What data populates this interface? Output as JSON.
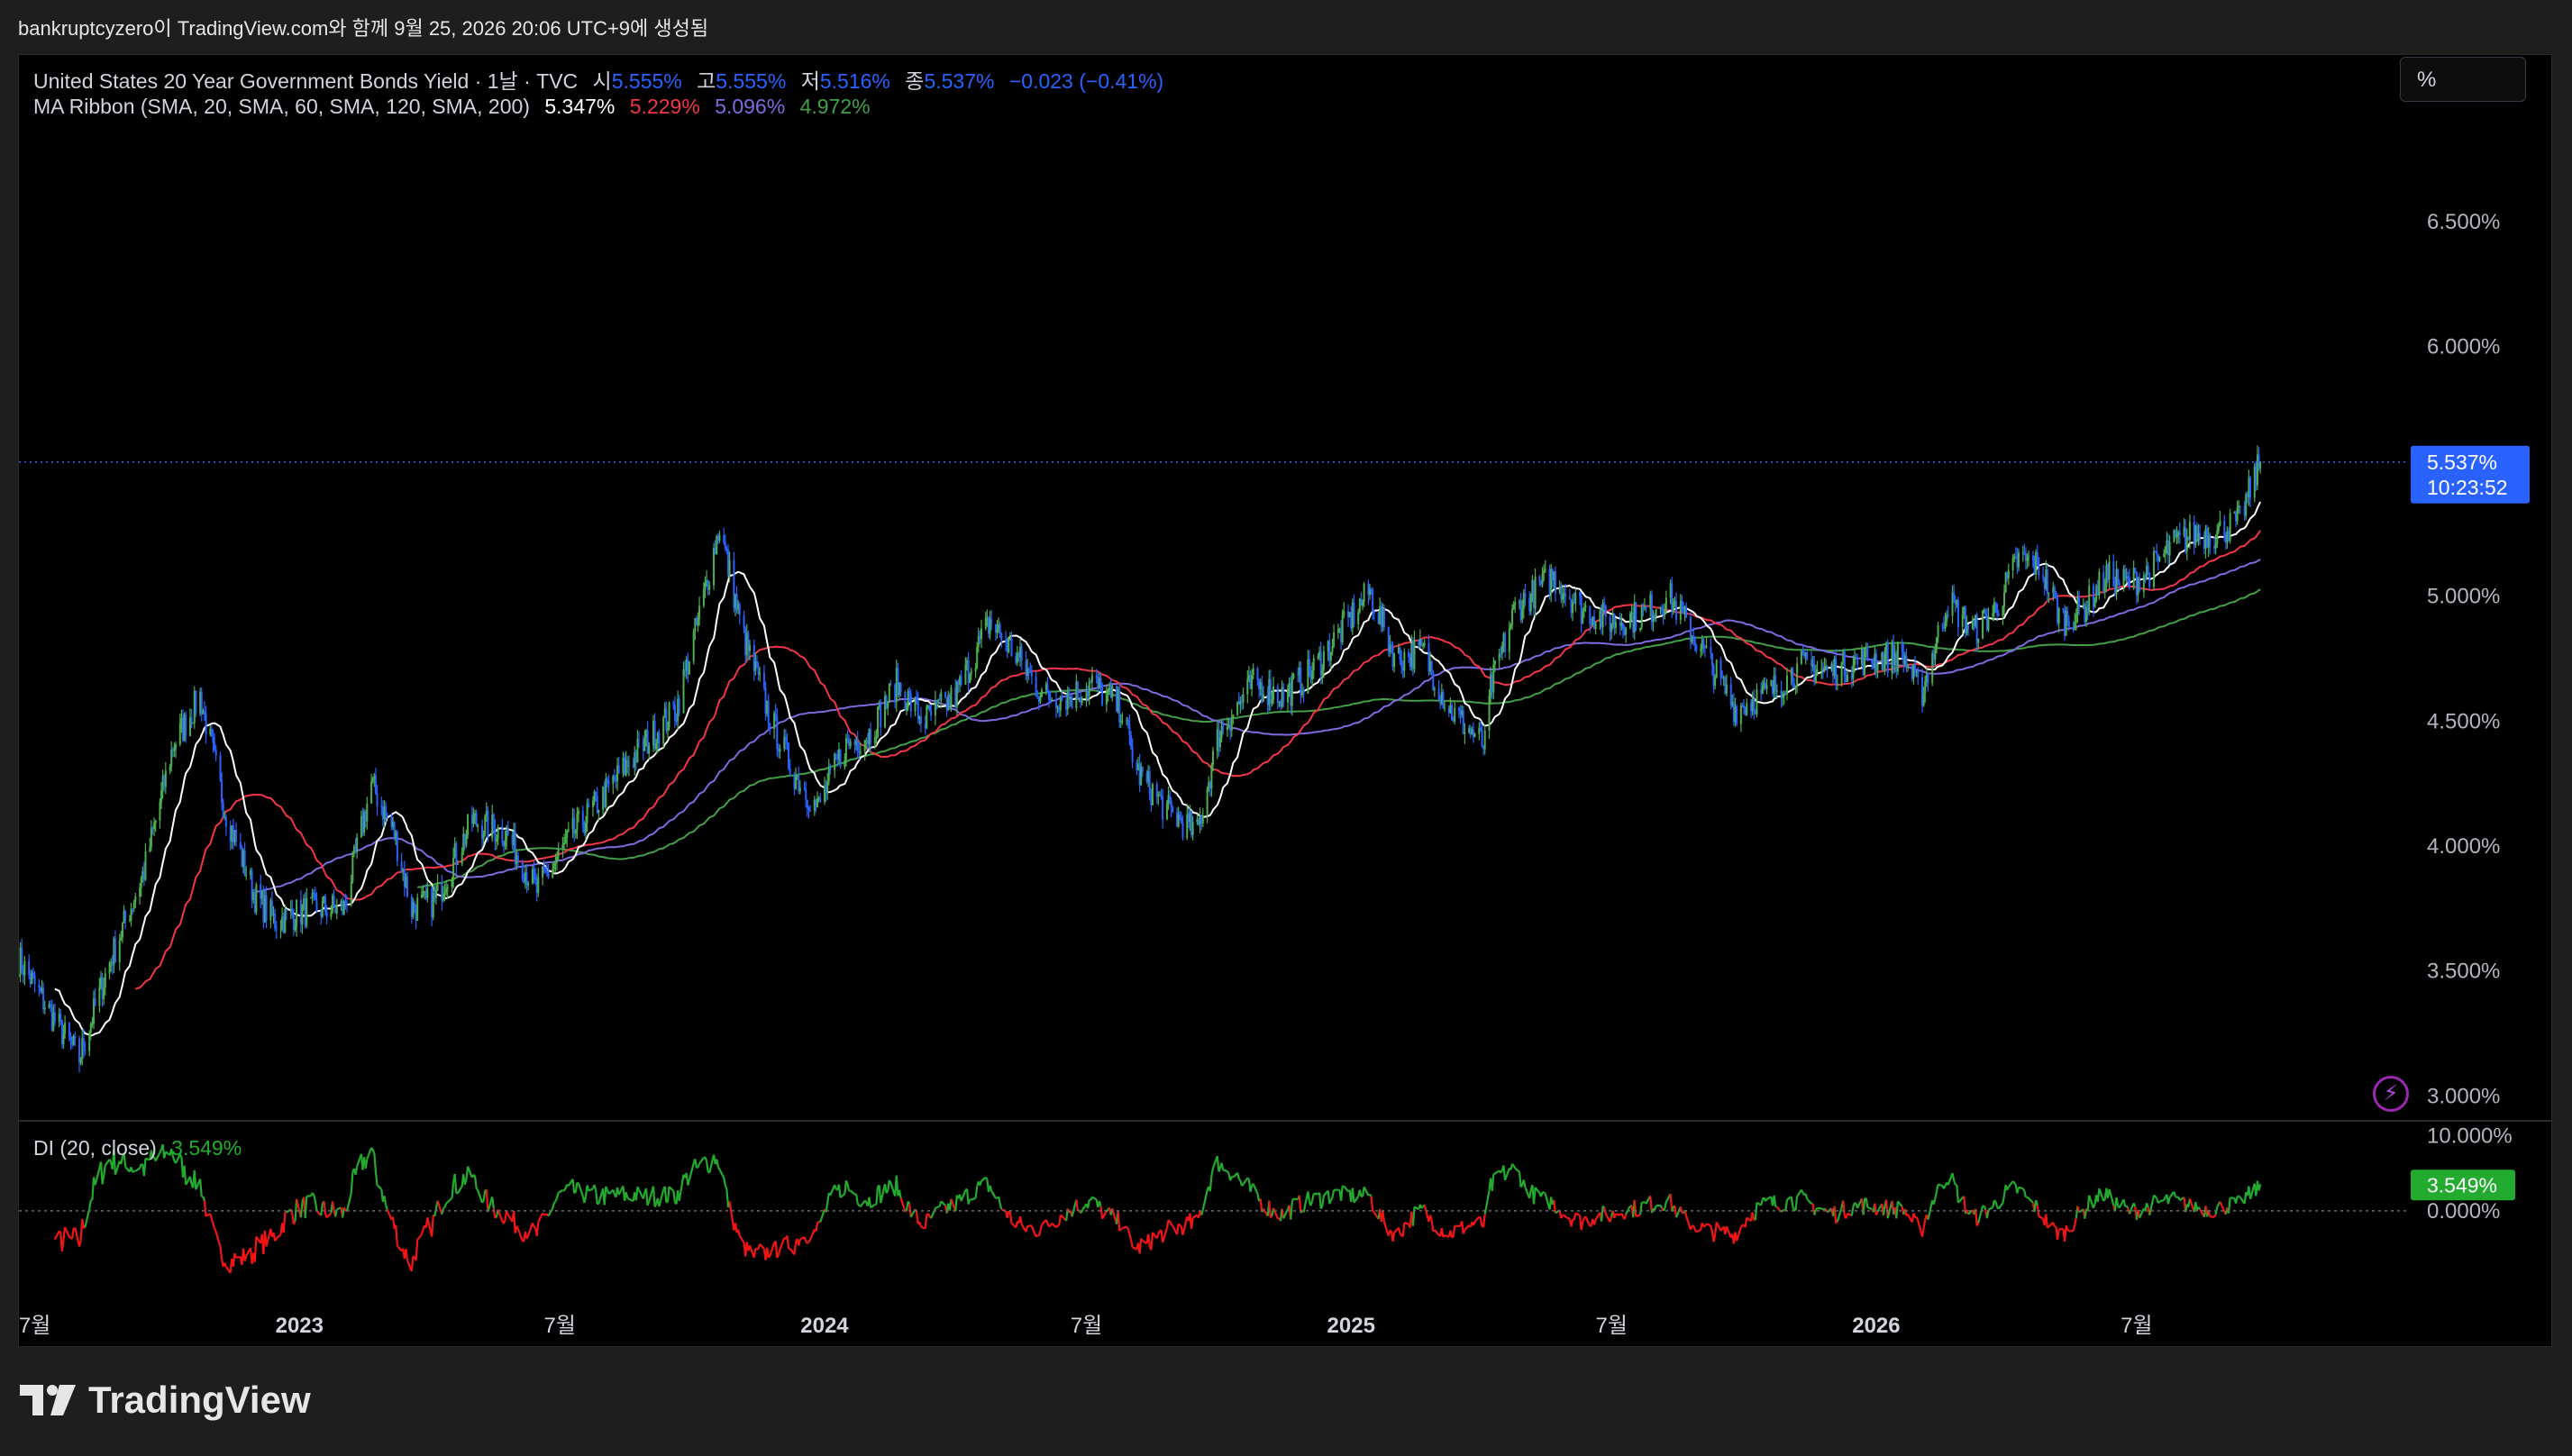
{
  "caption": "bankruptcyzero이 TradingView.com와 함께 9월 25, 2026 20:06 UTC+9에 생성됨",
  "legend": {
    "title": "United States 20 Year Government Bonds Yield · 1날 · TVC",
    "open_label": "시",
    "open": "5.555%",
    "high_label": "고",
    "high": "5.555%",
    "low_label": "저",
    "low": "5.516%",
    "close_label": "종",
    "close": "5.537%",
    "change": "−0.023 (−0.41%)",
    "ma_title": "MA Ribbon (SMA, 20, SMA, 60, SMA, 120, SMA, 200)",
    "ma20": "5.347%",
    "ma60": "5.229%",
    "ma120": "5.096%",
    "ma200": "4.972%"
  },
  "unit_button": "%",
  "price_badge": {
    "value": "5.537%",
    "countdown": "10:23:52"
  },
  "di_legend": {
    "label": "DI (20, close)",
    "value": "3.549%"
  },
  "di_badge": "3.549%",
  "brand": "TradingView",
  "colors": {
    "up": "#4caf50",
    "down": "#2962ff",
    "ma20": "#ffffff",
    "ma60": "#f23645",
    "ma120": "#7e6be0",
    "ma200": "#43a047",
    "di_up": "#22ab2e",
    "di_down": "#f21515",
    "badge_price": "#2962ff",
    "badge_di": "#22ab2e"
  },
  "chart_data": {
    "type": "line",
    "title": "United States 20 Year Government Bonds Yield",
    "y_ticks": [
      "6.500%",
      "6.000%",
      "5.000%",
      "4.500%",
      "4.000%",
      "3.500%",
      "3.000%"
    ],
    "y_tick_values": [
      6.5,
      6.0,
      5.0,
      4.5,
      4.0,
      3.5,
      3.0
    ],
    "ylim": [
      2.9,
      6.95
    ],
    "x_ticks": [
      {
        "label": "7월",
        "x": "2022-07-01"
      },
      {
        "label": "2023",
        "x": "2023-01-01"
      },
      {
        "label": "7월",
        "x": "2023-07-01"
      },
      {
        "label": "2024",
        "x": "2024-01-01"
      },
      {
        "label": "7월",
        "x": "2024-07-01"
      },
      {
        "label": "2025",
        "x": "2025-01-01"
      },
      {
        "label": "7월",
        "x": "2025-07-01"
      },
      {
        "label": "2026",
        "x": "2026-01-01"
      },
      {
        "label": "7월",
        "x": "2026-07-01"
      }
    ],
    "xlim": [
      "2022-06-20",
      "2027-01-05"
    ],
    "series": [
      {
        "name": "United States 20 Year Government Bonds Yield",
        "x": [
          "2022-06-20",
          "2022-07-15",
          "2022-08-01",
          "2022-08-20",
          "2022-09-15",
          "2022-10-05",
          "2022-10-24",
          "2022-11-10",
          "2022-12-01",
          "2022-12-15",
          "2023-01-10",
          "2023-02-01",
          "2023-02-20",
          "2023-03-08",
          "2023-03-20",
          "2023-04-05",
          "2023-05-01",
          "2023-05-25",
          "2023-06-15",
          "2023-07-10",
          "2023-07-31",
          "2023-08-20",
          "2023-09-20",
          "2023-10-05",
          "2023-10-20",
          "2023-11-05",
          "2023-11-25",
          "2023-12-10",
          "2023-12-27",
          "2024-01-15",
          "2024-02-01",
          "2024-02-20",
          "2024-03-10",
          "2024-04-01",
          "2024-04-25",
          "2024-05-15",
          "2024-06-01",
          "2024-06-20",
          "2024-07-05",
          "2024-07-25",
          "2024-08-05",
          "2024-08-25",
          "2024-09-16",
          "2024-10-01",
          "2024-10-25",
          "2024-11-15",
          "2024-12-05",
          "2025-01-14",
          "2025-02-01",
          "2025-02-20",
          "2025-03-10",
          "2025-04-04",
          "2025-04-08",
          "2025-04-25",
          "2025-05-21",
          "2025-06-10",
          "2025-07-01",
          "2025-07-20",
          "2025-08-10",
          "2025-09-01",
          "2025-09-25",
          "2025-10-20",
          "2025-11-10",
          "2025-12-01",
          "2025-12-25",
          "2026-01-20",
          "2026-02-01",
          "2026-02-20",
          "2026-03-10",
          "2026-03-25",
          "2026-04-10",
          "2026-04-25",
          "2026-05-10",
          "2026-05-25",
          "2026-06-10",
          "2026-06-25",
          "2026-07-10",
          "2026-07-25",
          "2026-08-10",
          "2026-08-25",
          "2026-09-10",
          "2026-09-25"
        ],
        "values": [
          3.55,
          3.3,
          3.15,
          3.5,
          3.9,
          4.4,
          4.6,
          4.15,
          3.8,
          3.7,
          3.75,
          3.75,
          4.25,
          4.05,
          3.75,
          3.78,
          4.1,
          4.05,
          3.82,
          4.05,
          4.2,
          4.35,
          4.55,
          4.9,
          5.28,
          4.85,
          4.5,
          4.3,
          4.15,
          4.4,
          4.45,
          4.65,
          4.5,
          4.6,
          4.9,
          4.75,
          4.6,
          4.6,
          4.65,
          4.55,
          4.3,
          4.15,
          4.05,
          4.45,
          4.65,
          4.6,
          4.7,
          5.02,
          4.75,
          4.78,
          4.55,
          4.4,
          4.63,
          4.95,
          5.08,
          4.95,
          4.9,
          4.92,
          5.0,
          4.8,
          4.55,
          4.62,
          4.72,
          4.7,
          4.75,
          4.76,
          4.6,
          4.98,
          4.86,
          4.95,
          5.15,
          5.12,
          4.9,
          4.95,
          5.08,
          5.05,
          5.1,
          5.2,
          5.25,
          5.25,
          5.3,
          5.537
        ]
      },
      {
        "name": "SMA 20",
        "current": 5.347
      },
      {
        "name": "SMA 60",
        "current": 5.229
      },
      {
        "name": "SMA 120",
        "current": 5.096
      },
      {
        "name": "SMA 200",
        "current": 4.972
      }
    ],
    "last_value": 5.537,
    "indicator": {
      "name": "DI (20, close)",
      "y_ticks": [
        "10.000%",
        "0.000%"
      ],
      "y_tick_values": [
        10,
        0
      ],
      "ylim": [
        -10,
        12
      ],
      "last_value": 3.549
    },
    "grid": false,
    "legend_position": "top-left"
  }
}
